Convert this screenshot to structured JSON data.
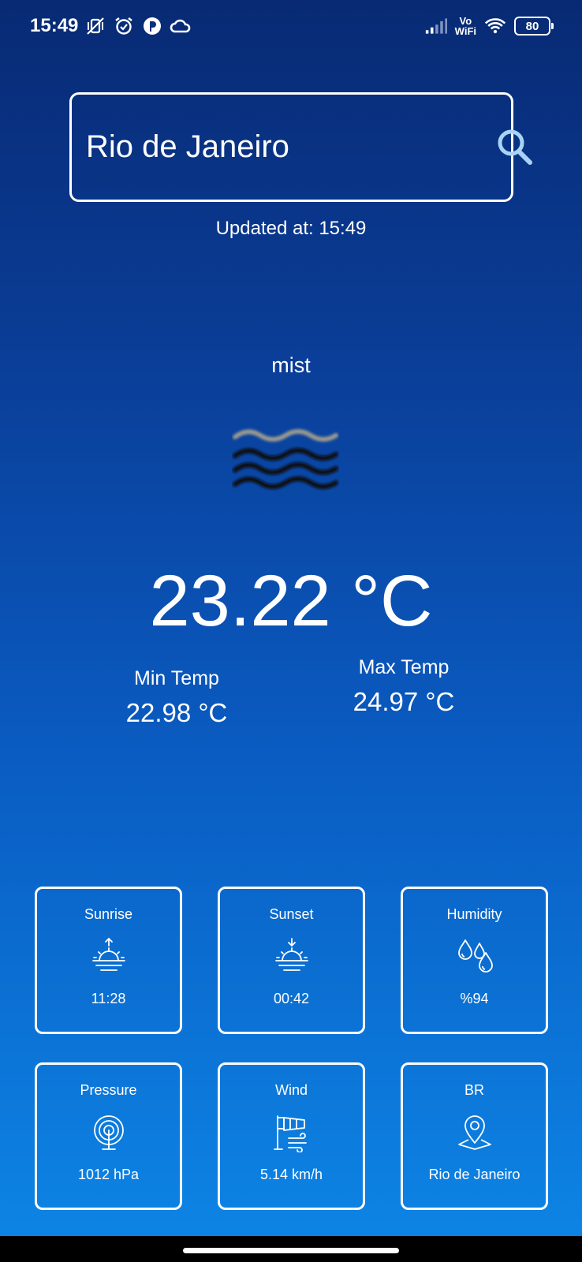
{
  "status_bar": {
    "time": "15:49",
    "vowifi_top": "Vo",
    "vowifi_bottom": "WiFi",
    "battery": "80"
  },
  "search": {
    "value": "Rio de Janeiro",
    "icon": "search-icon"
  },
  "updated_at": "Updated at: 15:49",
  "condition": "mist",
  "temperature": "23.22 °C",
  "min_temp": {
    "label": "Min Temp",
    "value": "22.98 °C"
  },
  "max_temp": {
    "label": "Max Temp",
    "value": "24.97 °C"
  },
  "cards": [
    {
      "title": "Sunrise",
      "icon": "sunrise-icon",
      "value": "11:28"
    },
    {
      "title": "Sunset",
      "icon": "sunset-icon",
      "value": "00:42"
    },
    {
      "title": "Humidity",
      "icon": "humidity-icon",
      "value": "%94"
    },
    {
      "title": "Pressure",
      "icon": "pressure-icon",
      "value": "1012 hPa"
    },
    {
      "title": "Wind",
      "icon": "wind-icon",
      "value": "5.14 km/h"
    },
    {
      "title": "BR",
      "icon": "location-pin-icon",
      "value": "Rio de Janeiro"
    }
  ],
  "colors": {
    "gradient_top": "#082a74",
    "gradient_bottom": "#0d86e6",
    "text": "#ffffff",
    "search_icon": "#a9d3f5"
  }
}
